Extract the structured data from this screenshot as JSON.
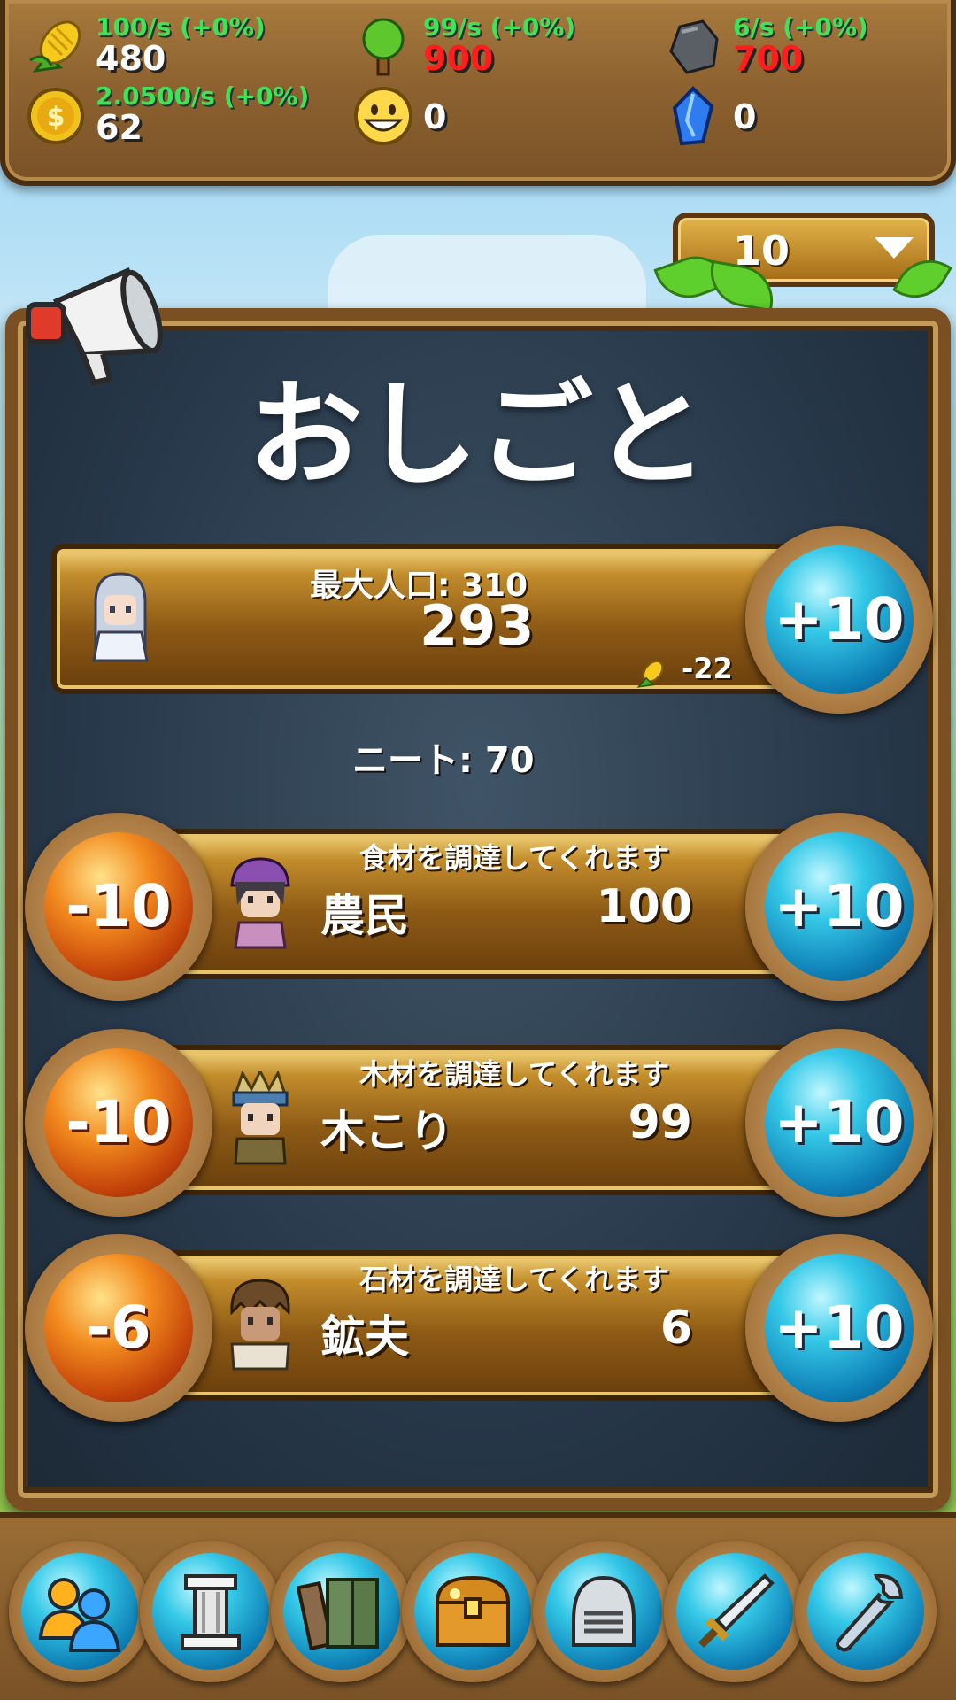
{
  "resources": {
    "food": {
      "rate": "100/s (+0%)",
      "amount": "480",
      "icon": "corn-icon"
    },
    "wood": {
      "rate": "99/s (+0%)",
      "amount": "900",
      "icon": "tree-icon"
    },
    "stone": {
      "rate": "6/s (+0%)",
      "amount": "700",
      "icon": "rock-icon"
    },
    "gold": {
      "rate": "2.0500/s (+0%)",
      "amount": "62",
      "icon": "gold-coin-icon"
    },
    "happiness": {
      "amount": "0",
      "icon": "smiley-icon"
    },
    "crystal": {
      "amount": "0",
      "icon": "blue-crystal-icon"
    }
  },
  "multiplier": {
    "value": "10"
  },
  "title": "おしごと",
  "population": {
    "label": "最大人口: 310",
    "current": "293",
    "food_cost": "-22",
    "add_label": "+10"
  },
  "neet": "ニート: 70",
  "jobs": [
    {
      "description": "食材を調達してくれます",
      "name": "農民",
      "count": "100",
      "minus_label": "-10",
      "plus_label": "+10"
    },
    {
      "description": "木材を調達してくれます",
      "name": "木こり",
      "count": "99",
      "minus_label": "-10",
      "plus_label": "+10"
    },
    {
      "description": "石材を調達してくれます",
      "name": "鉱夫",
      "count": "6",
      "minus_label": "-6",
      "plus_label": "+10"
    }
  ],
  "nav": [
    "people-icon",
    "pillar-icon",
    "books-icon",
    "treasure-chest-icon",
    "helmet-icon",
    "sword-icon",
    "wrench-icon"
  ]
}
